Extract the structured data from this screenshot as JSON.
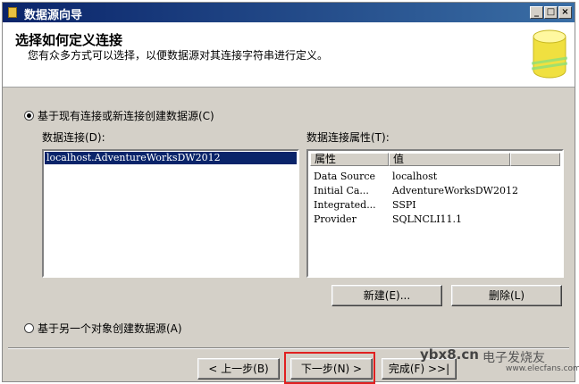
{
  "window": {
    "title": "数据源向导",
    "controls": [
      "_",
      "□",
      "×"
    ]
  },
  "header": {
    "title": "选择如何定义连接",
    "subtitle": "您有众多方式可以选择，以便数据源对其连接字符串进行定义。",
    "icon": "database-cylinder-icon"
  },
  "options": {
    "existing": {
      "label": "基于现有连接或新连接创建数据源(C)",
      "selected": true
    },
    "object": {
      "label": "基于另一个对象创建数据源(A)",
      "selected": false
    }
  },
  "connections": {
    "label": "数据连接(D):",
    "items": [
      "localhost.AdventureWorksDW2012"
    ],
    "selected_index": 0
  },
  "properties": {
    "label": "数据连接属性(T):",
    "columns": [
      "属性",
      "值"
    ],
    "rows": [
      {
        "name": "Data Source",
        "value": "localhost"
      },
      {
        "name": "Initial Ca...",
        "value": "AdventureWorksDW2012"
      },
      {
        "name": "Integrated...",
        "value": "SSPI"
      },
      {
        "name": "Provider",
        "value": "SQLNCLI11.1"
      }
    ]
  },
  "buttons": {
    "new": "新建(E)...",
    "delete": "删除(L)",
    "back": "< 上一步(B)",
    "next": "下一步(N) >",
    "finish": "完成(F) >>|"
  },
  "watermark": {
    "site": "ybx8.cn",
    "brand": "电子发烧友",
    "url": "www.elecfans.com"
  },
  "colors": {
    "titlebar": "#0a246a",
    "selection": "#0a246a",
    "highlight_box": "#e02020",
    "face": "#d4d0c8"
  }
}
